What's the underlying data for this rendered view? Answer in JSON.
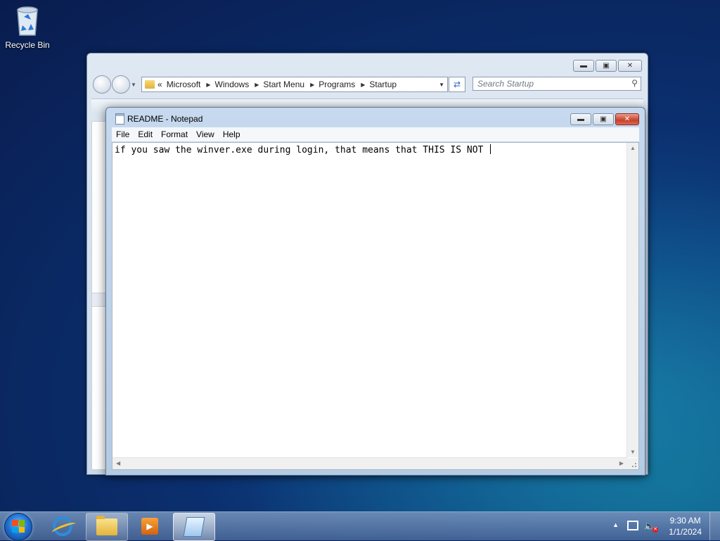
{
  "desktop": {
    "recycle_bin_label": "Recycle Bin"
  },
  "explorer": {
    "address": {
      "overflow": "«",
      "crumbs": [
        "Microsoft",
        "Windows",
        "Start Menu",
        "Programs",
        "Startup"
      ]
    },
    "search_placeholder": "Search Startup"
  },
  "notepad": {
    "title": "README - Notepad",
    "menu": [
      "File",
      "Edit",
      "Format",
      "View",
      "Help"
    ],
    "content": "if you saw the winver.exe during login, that means that THIS IS NOT "
  },
  "taskbar": {
    "clock_time": "9:30 AM",
    "clock_date": "1/1/2024",
    "pinned": [
      "internet-explorer",
      "windows-explorer",
      "windows-media-player",
      "notepad"
    ]
  },
  "colors": {
    "desktop_bg": "#0b2f6e",
    "window_frame": "#c6d9ee",
    "close_button": "#c7412b"
  }
}
